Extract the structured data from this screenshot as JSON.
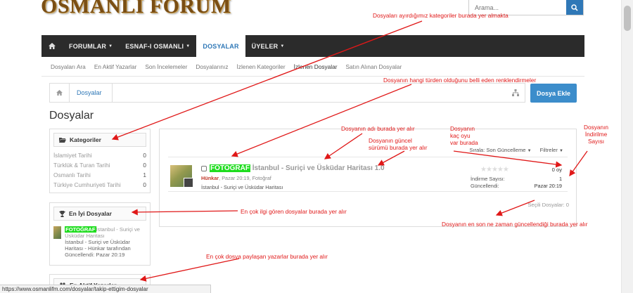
{
  "header": {
    "logo_text": "OSMANLI FORUM",
    "search_placeholder": "Arama..."
  },
  "nav": {
    "home_icon": "home-icon",
    "items": [
      {
        "label": "FORUMLAR",
        "dropdown": true
      },
      {
        "label": "ESNAF-I OSMANLI",
        "dropdown": true
      },
      {
        "label": "DOSYALAR",
        "dropdown": false,
        "active": true
      },
      {
        "label": "ÜYELER",
        "dropdown": true
      }
    ]
  },
  "subnav": [
    "Dosyaları Ara",
    "En Aktif Yazarlar",
    "Son İncelemeler",
    "Dosyalarınız",
    "İzlenen Kategoriler",
    "İzlenen Dosyalar",
    "Satın Alınan Dosyalar"
  ],
  "breadcrumb": {
    "items": [
      "Dosyalar"
    ]
  },
  "add_button": "Dosya Ekle",
  "page_title": "Dosyalar",
  "categories": {
    "title": "Kategoriler",
    "items": [
      {
        "name": "İslamiyet Tarihi",
        "count": "0"
      },
      {
        "name": "Türklük & Turan Tarihi",
        "count": "0"
      },
      {
        "name": "Osmanlı Tarihi",
        "count": "1"
      },
      {
        "name": "Türkiye Cumhuriyeti Tarihi",
        "count": "0"
      }
    ]
  },
  "best_files": {
    "title": "En İyi Dosyalar",
    "tag": "FOTOĞRAF",
    "title_rest": "İstanbul - Suriçi ve Üsküdar Haritası",
    "line2": "İstanbul - Suriçi ve Üsküdar Haritası - Hünkar tarafından",
    "line3": "Güncellendi: Pazar 20:19"
  },
  "top_authors": {
    "title": "En Aktif Yazarlar"
  },
  "file_list": {
    "sort_label": "Sırala: Son Güncelleme",
    "filter_label": "Filtreler",
    "items": [
      {
        "tag": "FOTOĞRAF",
        "title": "İstanbul - Suriçi ve Üsküdar Haritası 1.0",
        "author": "Hünkar",
        "meta_rest": ", Pazar 20:19, Fotoğraf",
        "description": "İstanbul - Suriçi ve Üsküdar Haritası",
        "votes": "0 oy",
        "downloads_label": "İndirme Sayısı:",
        "downloads": "1",
        "updated_label": "Güncellendi:",
        "updated": "Pazar 20:19"
      }
    ],
    "selected_label": "Seçili Dosyalar: 0"
  },
  "status_url": "https://www.osmanlifm.com/dosyalar/takip-ettigim-dosyalar",
  "annotations": {
    "categories_note": "Dosyaları ayırdığımız kategoriler burada yer almakta",
    "color_note": "Dosyanın hangi türden olduğunu belli eden renklendirmeler",
    "name_note": "Dosyanın adı burada yer alır",
    "version_note": [
      "Dosyanın güncel",
      "sürümü burada yer alır"
    ],
    "votes_note": [
      "Dosyanın",
      "kaç oyu",
      "var burada"
    ],
    "downloads_note": [
      "Dosyanın",
      "İndirilme",
      "Sayısı"
    ],
    "best_note": "En çok ilgi gören dosyalar burada yer alır",
    "updated_note": "Dosyanın en son ne zaman güncellendiği burada yer alır",
    "authors_note": "En çok dosya paylaşan yazarlar burada yer alır"
  },
  "colors": {
    "nav_bg": "#2b2b2b",
    "accent": "#2f78b7",
    "tag_green": "#1fdd1f",
    "annotation_red": "#e01818"
  }
}
